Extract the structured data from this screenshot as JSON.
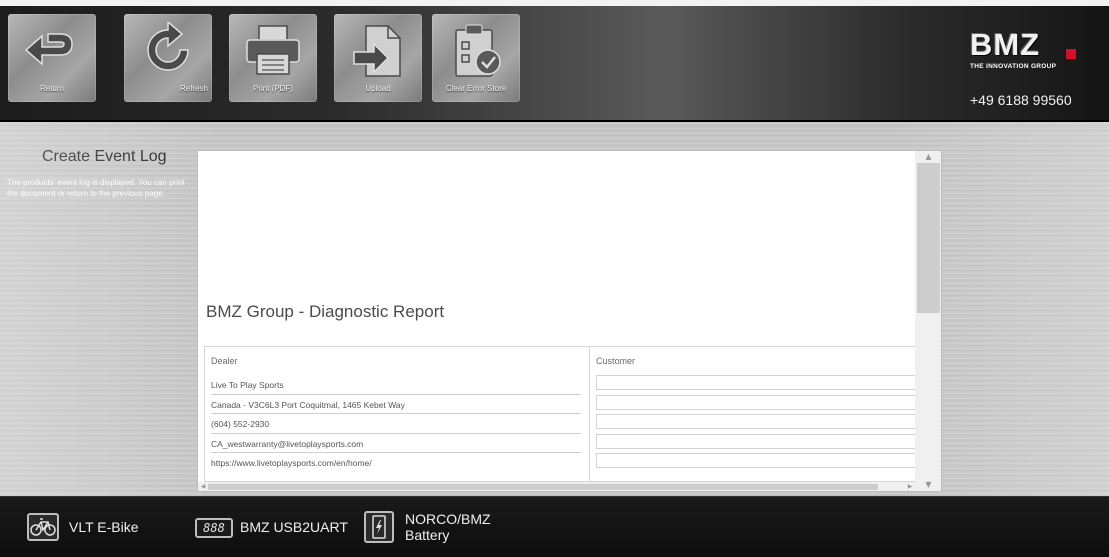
{
  "toolbar": {
    "buttons": [
      {
        "label": "Return",
        "icon": "return-arrow-icon"
      },
      {
        "label": "Refresh",
        "icon": "refresh-icon"
      },
      {
        "label": "Print (PDF)",
        "icon": "printer-icon"
      },
      {
        "label": "Upload",
        "icon": "upload-icon"
      },
      {
        "label": "Clear Error Store",
        "icon": "clipboard-check-icon"
      }
    ]
  },
  "brand": {
    "logo": "BMZ",
    "tagline": "THE INNOVATION GROUP",
    "phone": "+49 6188 99560",
    "accent_color": "#d50f2a"
  },
  "sidebar": {
    "title": "Create Event Log",
    "description": "The products' event log is displayed. You can print the document or return to the previous page."
  },
  "report": {
    "title": "BMZ Group - Diagnostic Report",
    "dealer": {
      "heading": "Dealer",
      "lines": [
        "Live To Play Sports",
        "Canada - V3C6L3 Port Coquitmal, 1465 Kebet Way",
        "(604) 552-2930",
        "CA_westwarranty@livetoplaysports.com",
        "https://www.livetoplaysports.com/en/home/"
      ]
    },
    "customer": {
      "heading": "Customer",
      "fields": [
        "",
        "",
        "",
        "",
        ""
      ]
    }
  },
  "statusbar": {
    "ebike": "VLT E-Bike",
    "uart": "BMZ USB2UART",
    "uart_icon_text": "888",
    "battery_line1": "NORCO/BMZ",
    "battery_line2": "Battery"
  }
}
